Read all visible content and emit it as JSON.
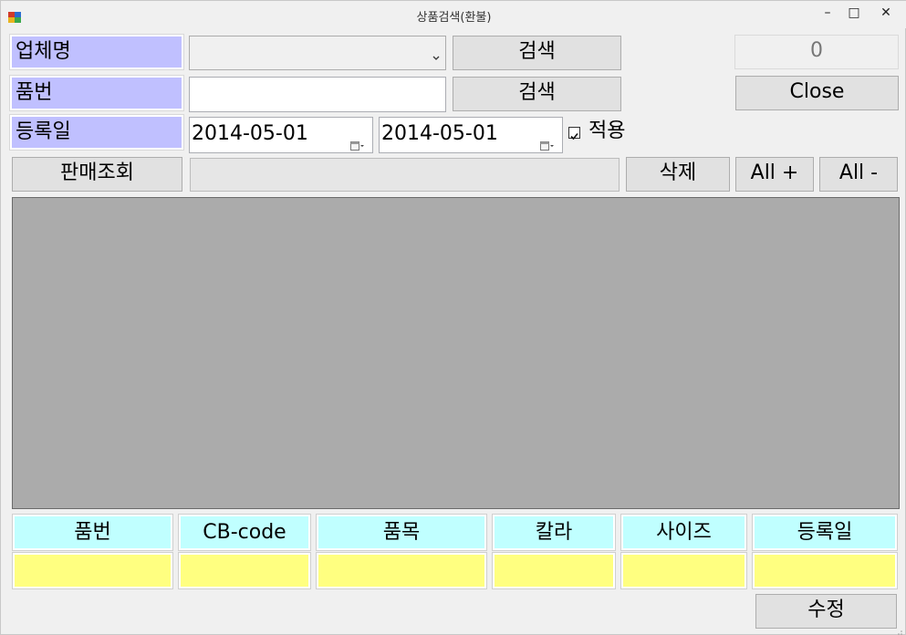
{
  "window": {
    "title": "상품검색(환불)",
    "minimize": "–",
    "maximize": "□",
    "close": "✕"
  },
  "search": {
    "vendor_label": "업체명",
    "vendor_value": "",
    "vendor_search": "검색",
    "count": "0",
    "item_label": "품번",
    "item_value": "",
    "item_search": "검색",
    "close_button": "Close",
    "date_label": "등록일",
    "date_from": "2014-05-01",
    "date_to": "2014-05-01",
    "apply_label": "적용",
    "apply_checked": true
  },
  "actions": {
    "sales_query": "판매조회",
    "delete": "삭제",
    "all_plus": "All +",
    "all_minus": "All -"
  },
  "details": {
    "headers": [
      "품번",
      "CB-code",
      "품목",
      "칼라",
      "사이즈",
      "등록일"
    ],
    "values": [
      "",
      "",
      "",
      "",
      "",
      ""
    ]
  },
  "footer": {
    "edit": "수정"
  },
  "colors": {
    "label_bg": "#c0c0ff",
    "header_bg": "#c0ffff",
    "value_bg": "#ffff80",
    "grid_bg": "#ababab"
  }
}
